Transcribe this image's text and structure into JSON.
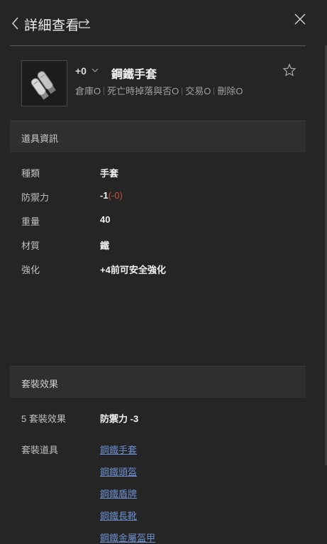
{
  "header": {
    "title": "詳細查看"
  },
  "item": {
    "enhance": "+0",
    "name": "鋼鐵手套",
    "attrs": [
      "倉庫O",
      "死亡時掉落與否O",
      "交易O",
      "刪除O"
    ]
  },
  "info": {
    "heading": "道具資訊",
    "rows": [
      {
        "k": "種類",
        "v": "手套"
      },
      {
        "k": "防禦力",
        "v": "-1",
        "extra": "(-0)"
      },
      {
        "k": "重量",
        "v": "40"
      },
      {
        "k": "材質",
        "v": "鐵"
      },
      {
        "k": "強化",
        "v": "+4前可安全強化"
      }
    ]
  },
  "set": {
    "heading": "套裝效果",
    "effect_label": "5 套裝效果",
    "effect_value": "防禦力 -3",
    "items_label": "套裝道具",
    "items": [
      "鋼鐵手套",
      "鋼鐵頭盔",
      "鋼鐵盾牌",
      "鋼鐵長靴",
      "鋼鐵金屬盔甲"
    ]
  },
  "colors": {
    "background": "#252525",
    "section": "#2f2f2f",
    "link": "#6d8fcf",
    "negative": "#c0503a"
  },
  "icons": [
    "back-chevron-icon",
    "share-icon",
    "close-icon",
    "chevron-down-icon",
    "star-icon",
    "glove-item-icon"
  ]
}
